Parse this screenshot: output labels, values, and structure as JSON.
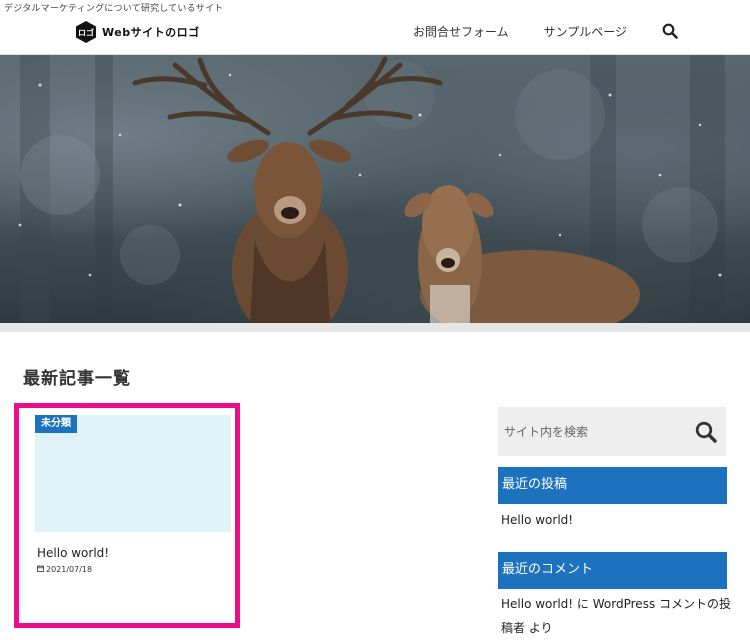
{
  "header": {
    "tagline": "デジタルマーケティングについて研究しているサイト",
    "logo_mark_text": "ロゴ",
    "logo_text": "Webサイトのロゴ",
    "nav": [
      {
        "label": "お問合せフォーム"
      },
      {
        "label": "サンプルページ"
      }
    ]
  },
  "hero": {
    "alt": "雪の森の中の2頭の鹿"
  },
  "main": {
    "section_title": "最新記事一覧",
    "posts": [
      {
        "category": "未分類",
        "title": "Hello world!",
        "date": "2021/07/18"
      }
    ]
  },
  "sidebar": {
    "search": {
      "placeholder": "サイト内を検索"
    },
    "recent_posts": {
      "heading": "最近の投稿",
      "items": [
        {
          "label": "Hello world!"
        }
      ]
    },
    "recent_comments": {
      "heading": "最近のコメント",
      "items": [
        {
          "post": "Hello world!",
          "connector": "に",
          "author": "WordPress コメントの投稿者",
          "suffix": "より"
        }
      ]
    }
  },
  "colors": {
    "accent_blue": "#1d72c0",
    "highlight_pink": "#ec0c8c",
    "thumb_bg": "#e2f2f9",
    "search_bg": "#eeeeee"
  }
}
